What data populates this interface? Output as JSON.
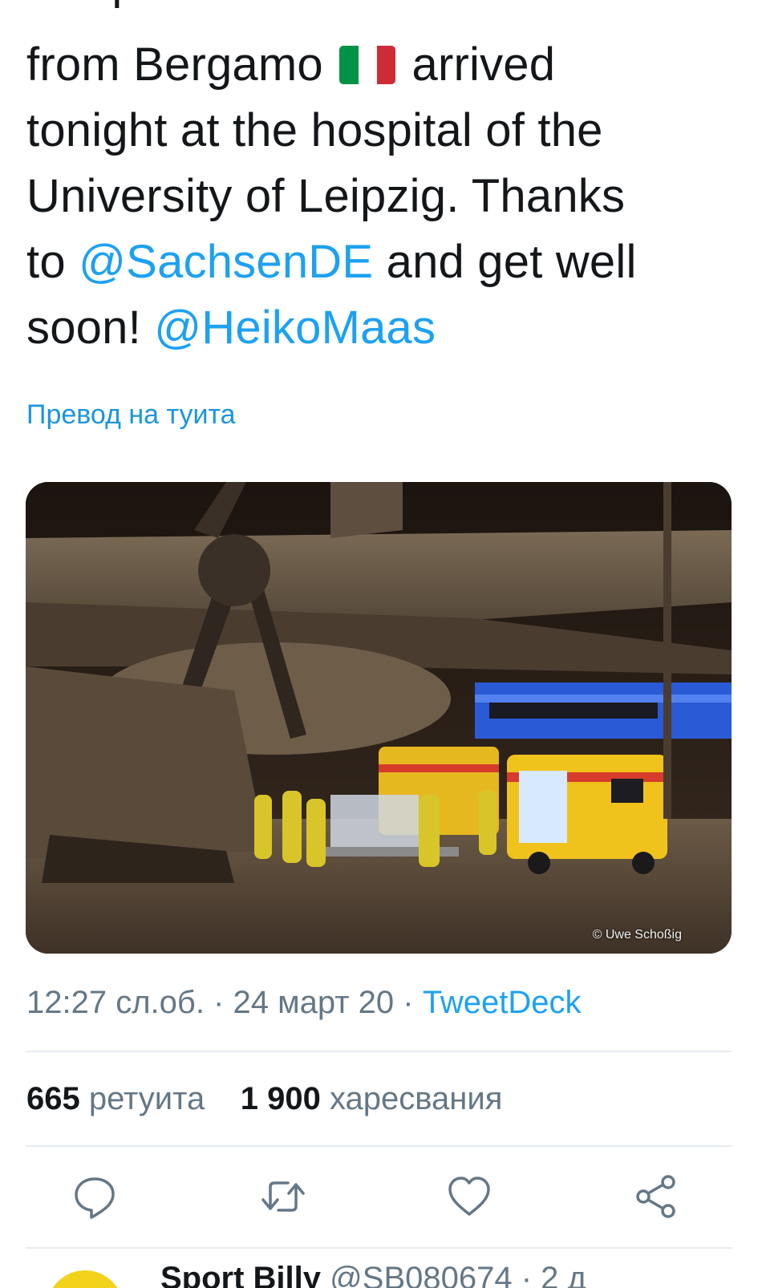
{
  "tweet": {
    "text_cut": "two patients in intensive care",
    "line1_before_flag": "from Bergamo",
    "line1_after_flag": "arrived",
    "line2": "tonight at the hospital of the",
    "line3": "University of Leipzig. Thanks",
    "line4_prefix": "to",
    "mention1": "@SachsenDE",
    "line4_suffix": "and get well",
    "line5_prefix": "soon!",
    "mention2": "@HeikoMaas",
    "flag_icon": "italy-flag-icon",
    "flag_colors": [
      "#009246",
      "#ffffff",
      "#ce2b37"
    ]
  },
  "translate_label": "Превод на туита",
  "photo": {
    "credit": "© Uwe Schoßig",
    "description_icon": "airplane-ambulance-photo"
  },
  "meta": {
    "time": "12:27 сл.об.",
    "separator1": " · ",
    "date": "24 март 20",
    "separator2": " · ",
    "source": "TweetDeck"
  },
  "stats": {
    "retweets_count": "665",
    "retweets_label": "ретуита",
    "likes_count": "1 900",
    "likes_label": "харесвания"
  },
  "actions": [
    {
      "name": "reply",
      "icon": "reply-icon"
    },
    {
      "name": "retweet",
      "icon": "retweet-icon"
    },
    {
      "name": "like",
      "icon": "heart-icon"
    },
    {
      "name": "share",
      "icon": "share-icon"
    }
  ],
  "next_tweet": {
    "name": "Sport Billy",
    "handle": "@SB080674 · 2 д"
  },
  "colors": {
    "text": "#14171a",
    "accent": "#1da1f2",
    "muted": "#657786",
    "divider": "#e6ecf0"
  }
}
